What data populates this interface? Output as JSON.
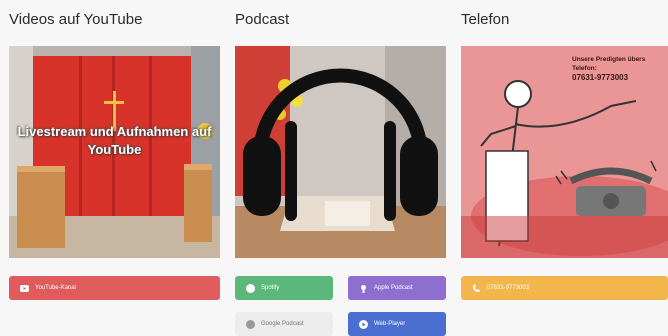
{
  "sections": {
    "videos": {
      "title": "Videos auf YouTube",
      "overlay": "Livestream und Aufnahmen auf YouTube",
      "button": {
        "label": "YouTube-Kanal",
        "color": "#e05c5c",
        "icon": "youtube-icon"
      }
    },
    "podcast": {
      "title": "Podcast",
      "buttons": [
        {
          "label": "Spotify",
          "color": "#5cb87a",
          "icon": "spotify-icon"
        },
        {
          "label": "Apple Podcast",
          "color": "#8e6fcf",
          "icon": "apple-podcast-icon"
        },
        {
          "label": "Google Podcast",
          "color": "#ececec",
          "icon": "google-podcast-icon"
        },
        {
          "label": "Web-Player",
          "color": "#4a6fd0",
          "icon": "web-player-icon"
        }
      ]
    },
    "phone": {
      "title": "Telefon",
      "image_text": "Unsere Predigten übers Telefon:",
      "image_number": "07631-9773003",
      "button": {
        "label": "07631-9773003",
        "color": "#f2b64c",
        "icon": "phone-icon"
      }
    }
  }
}
